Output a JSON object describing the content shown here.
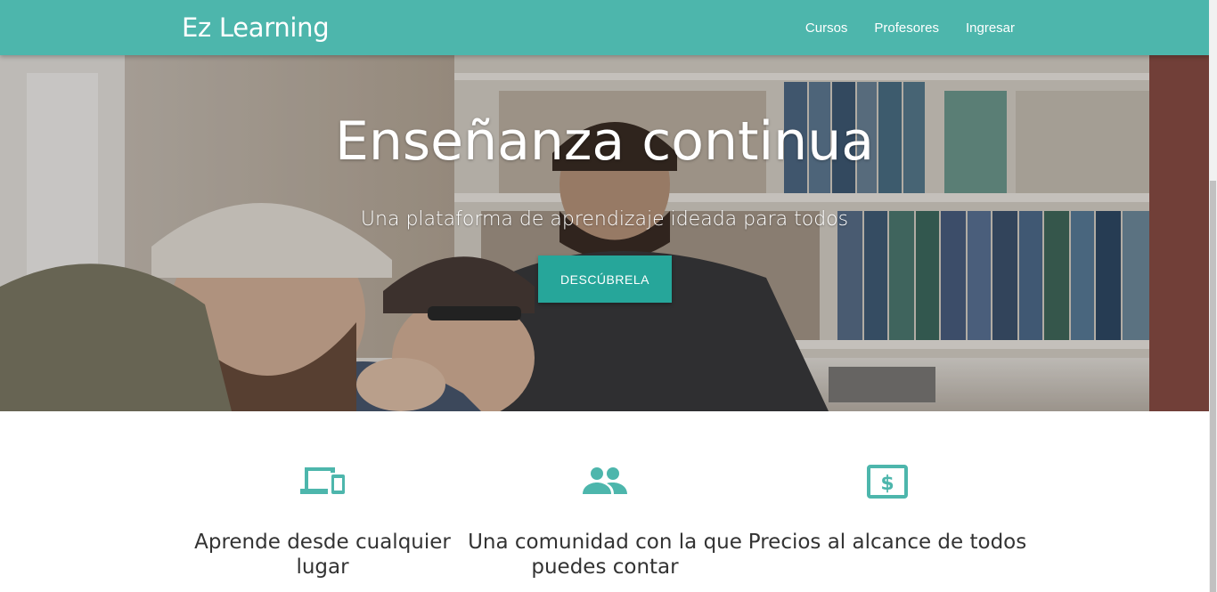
{
  "brand": "Ez Learning",
  "nav": {
    "items": [
      {
        "label": "Cursos"
      },
      {
        "label": "Profesores"
      },
      {
        "label": "Ingresar"
      }
    ]
  },
  "hero": {
    "title": "Enseñanza continua",
    "subtitle": "Una plataforma de aprendizaje ideada para todos",
    "cta_label": "DESCÚBRELA"
  },
  "features": [
    {
      "icon": "devices-icon",
      "text": "Aprende desde cualquier lugar"
    },
    {
      "icon": "people-icon",
      "text": "Una comunidad con la que puedes contar"
    },
    {
      "icon": "dollar-bill-icon",
      "text": "Precios al alcance de todos"
    }
  ],
  "colors": {
    "primary": "#4db6ac",
    "button": "#26a69a",
    "text": "#333333"
  }
}
